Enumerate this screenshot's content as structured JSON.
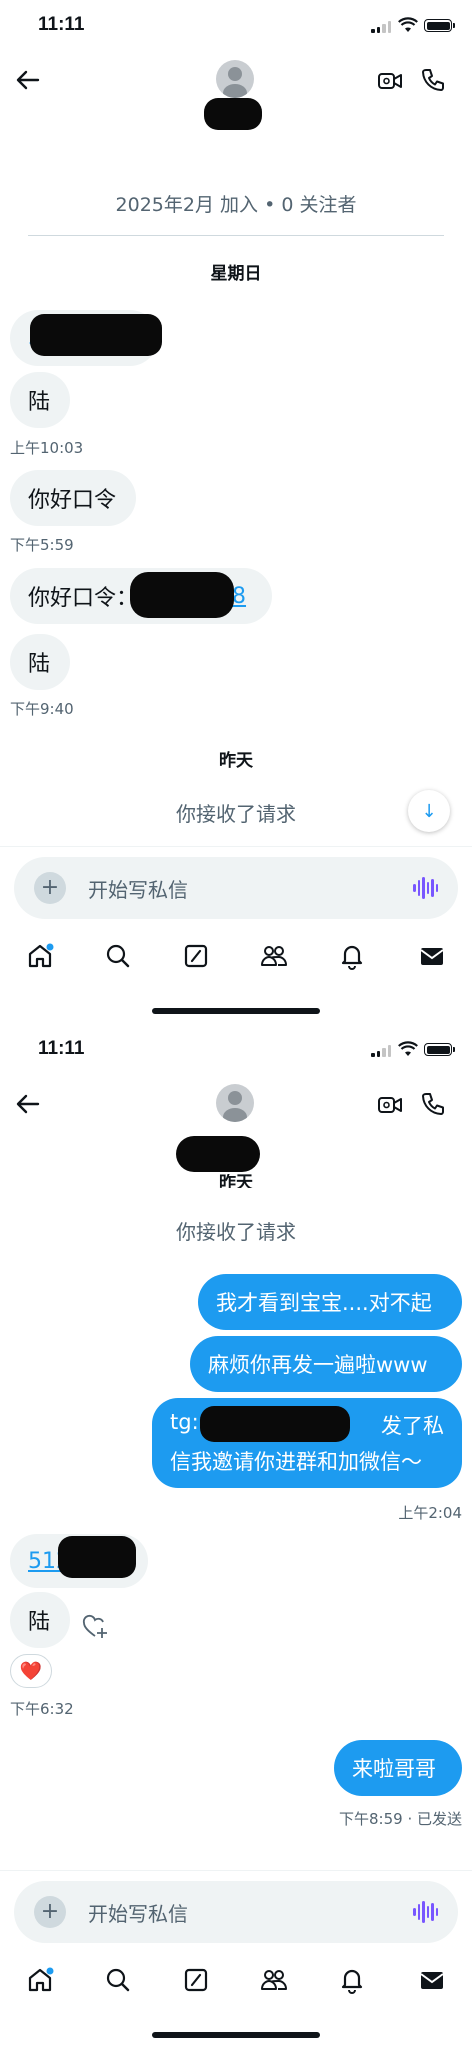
{
  "status_bar": {
    "time": "11:11"
  },
  "conversation": {
    "joined_info": "2025年2月 加入 • 0 关注者",
    "day_sunday": "星期日",
    "day_yesterday": "昨天",
    "accepted_notice": "你接收了请求",
    "yesterday_partial": "昨天"
  },
  "messages_first": [
    {
      "text": "陆",
      "time": "上午10:03"
    },
    {
      "text": "你好口令",
      "time": "下午5:59"
    },
    {
      "text_prefix": "你好口令：",
      "link_visible": "98"
    },
    {
      "text": "陆",
      "time": "下午9:40"
    }
  ],
  "messages_second": {
    "out1": "我才看到宝宝....对不起",
    "out2": "麻烦你再发一遍啦www",
    "out3_line1_prefix": "tg:",
    "out3_line1_suffix": "发了私",
    "out3_line2": "信我邀请你进群和加微信～",
    "out_time": "上午2:04",
    "in_link": "512",
    "in_text": "陆",
    "reaction": "❤️",
    "in_time": "下午6:32",
    "out4": "来啦哥哥",
    "out4_time": "下午8:59 · 已发送"
  },
  "composer": {
    "placeholder": "开始写私信"
  },
  "tabs": [
    "home-icon",
    "search-icon",
    "grok-icon",
    "communities-icon",
    "notifications-icon",
    "messages-icon"
  ],
  "colors": {
    "accent": "#1d9bf0",
    "bubble_in": "#eff3f4",
    "muted": "#536471",
    "voice": "#7856ff"
  }
}
